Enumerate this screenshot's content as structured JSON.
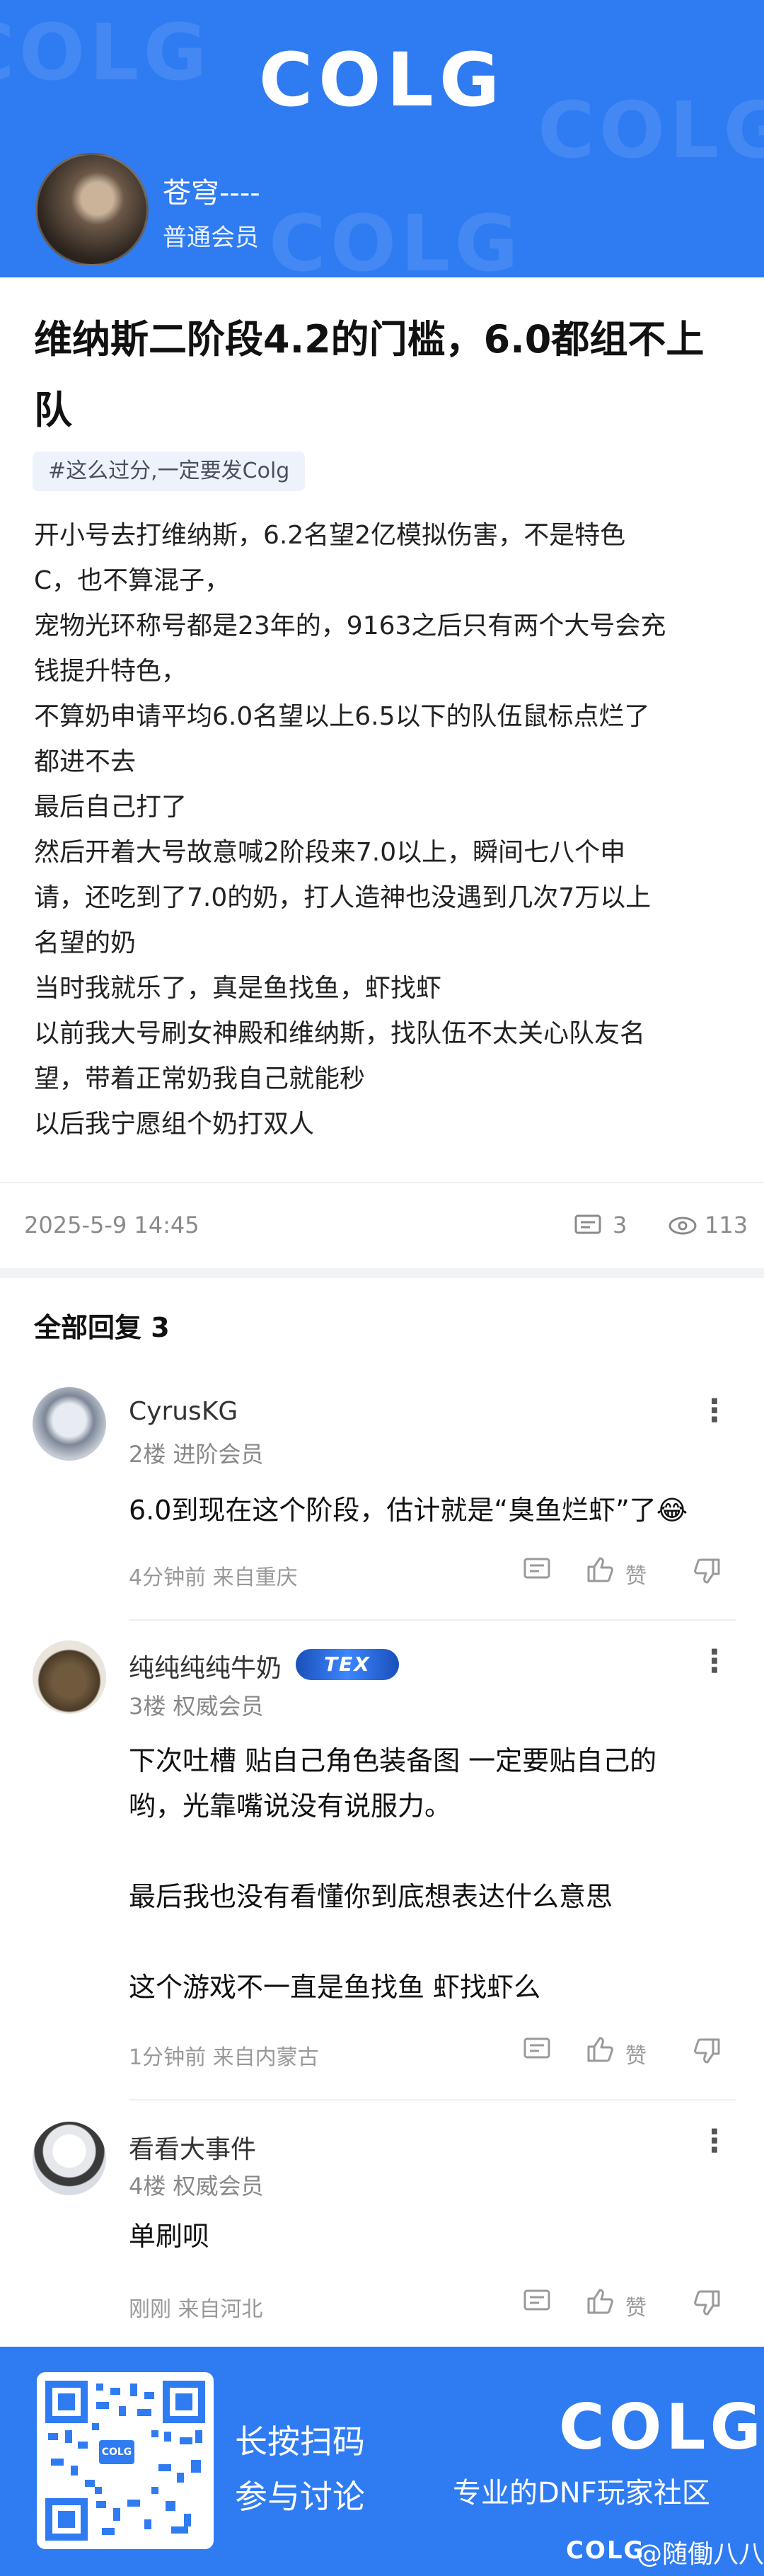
{
  "header": {
    "logo": "COLG",
    "author_name": "苍穹----",
    "author_level": "普通会员"
  },
  "post": {
    "title_line1": "维纳斯二阶段4.2的门槛，6.0都组不上",
    "title_line2": "队",
    "tag": "#这么过分,一定要发Colg",
    "body": [
      "开小号去打维纳斯，6.2名望2亿模拟伤害，不是特色",
      "C，也不算混子，",
      "宠物光环称号都是23年的，9163之后只有两个大号会充",
      "钱提升特色，",
      "不算奶申请平均6.0名望以上6.5以下的队伍鼠标点烂了",
      "都进不去",
      "最后自己打了",
      "然后开着大号故意喊2阶段来7.0以上，瞬间七八个申",
      "请，还吃到了7.0的奶，打人造神也没遇到几次7万以上",
      "名望的奶",
      "当时我就乐了，真是鱼找鱼，虾找虾",
      "以前我大号刷女神殿和维纳斯，找队伍不太关心队友名",
      "望，带着正常奶我自己就能秒",
      "以后我宁愿组个奶打双人"
    ],
    "date": "2025-5-9 14:45",
    "comment_count": "3",
    "view_count": "113"
  },
  "replies": {
    "title": "全部回复  3",
    "items": [
      {
        "name": "CyrusKG",
        "sub": "2楼  进阶会员",
        "text": [
          "6.0到现在这个阶段，估计就是“臭鱼烂虾”了😂"
        ],
        "time": "4分钟前  来自重庆",
        "like_label": "赞"
      },
      {
        "name": "纯纯纯纯牛奶",
        "badge": "TEX",
        "sub": "3楼  权威会员",
        "text": [
          "下次吐槽 贴自己角色装备图 一定要贴自己的",
          "哟，光靠嘴说没有说服力。",
          "",
          "最后我也没有看懂你到底想表达什么意思",
          "",
          "这个游戏不一直是鱼找鱼 虾找虾么"
        ],
        "time": "1分钟前  来自内蒙古",
        "like_label": "赞"
      },
      {
        "name": "看看大事件",
        "sub": "4楼  权威会员",
        "text": [
          "单刷呗"
        ],
        "time": "刚刚  来自河北",
        "like_label": "赞"
      }
    ]
  },
  "footer": {
    "cta_line1": "长按扫码",
    "cta_line2": "参与讨论",
    "logo": "COLG",
    "slogan": "专业的DNF玩家社区",
    "qr_label": "COLG",
    "mini_logo": "COLG",
    "watermark_user": "@随働八八"
  },
  "colors": {
    "brand_blue": "#2f7bf2",
    "tag_bg": "#eef2fb"
  },
  "icons": [
    "comment-icon",
    "eye-icon",
    "more-icon",
    "reply-icon",
    "thumbs-up-icon",
    "thumbs-down-icon"
  ]
}
